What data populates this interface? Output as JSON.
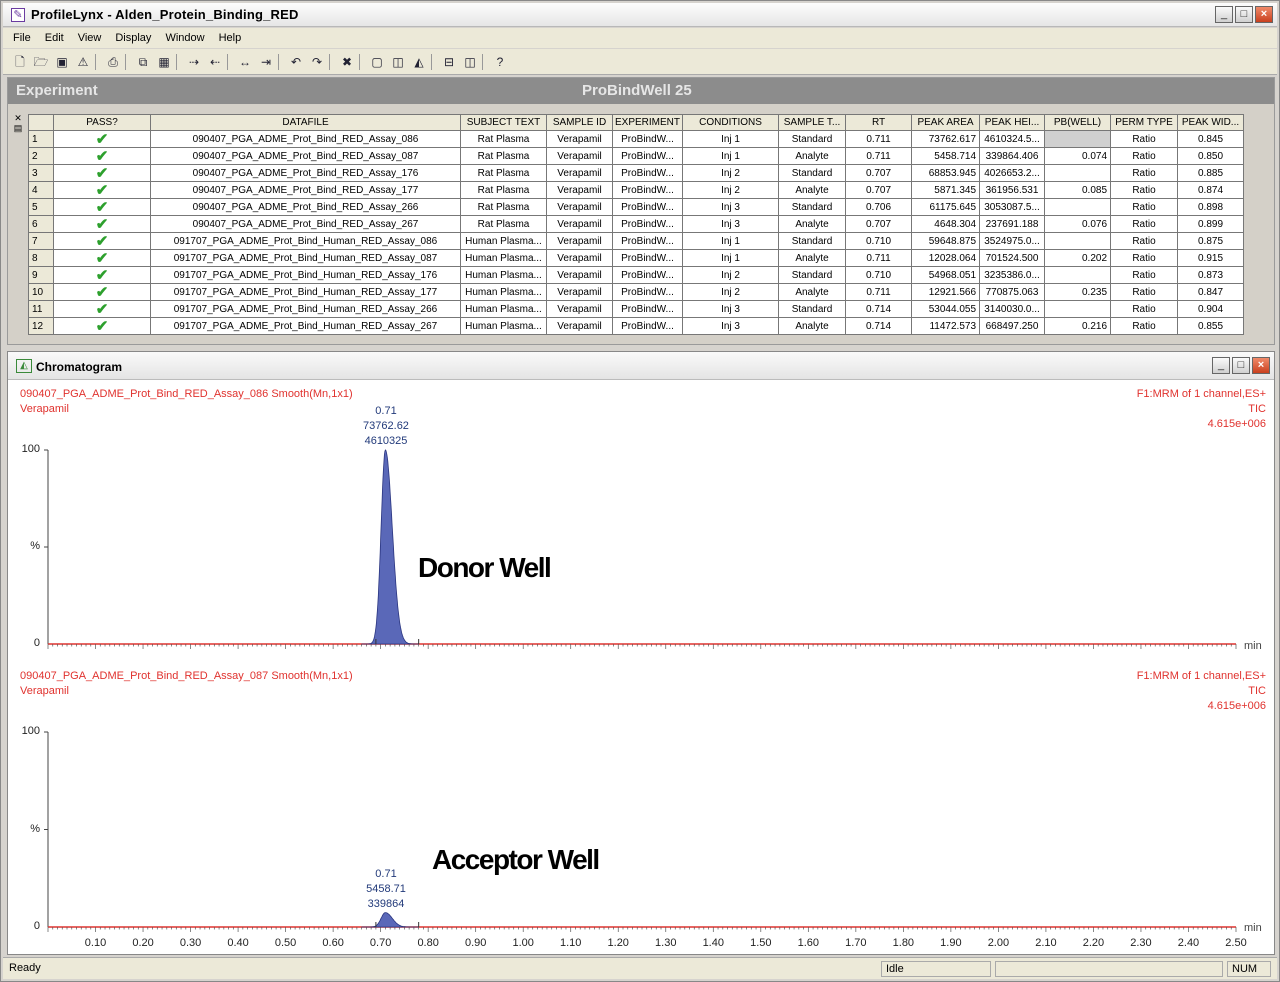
{
  "window": {
    "title": "ProfileLynx - Alden_Protein_Binding_RED"
  },
  "menu": [
    "File",
    "Edit",
    "View",
    "Display",
    "Window",
    "Help"
  ],
  "experiment": {
    "label": "Experiment",
    "name": "ProBindWell 25"
  },
  "grid": {
    "columns": [
      "PASS?",
      "DATAFILE",
      "SUBJECT TEXT",
      "SAMPLE ID",
      "EXPERIMENT",
      "CONDITIONS",
      "SAMPLE T...",
      "RT",
      "PEAK AREA",
      "PEAK HEI...",
      "PB(WELL)",
      "PERM TYPE",
      "PEAK WID..."
    ],
    "rows": [
      {
        "n": "1",
        "file": "090407_PGA_ADME_Prot_Bind_RED_Assay_086",
        "subject": "Rat Plasma",
        "sample": "Verapamil",
        "exp": "ProBindW...",
        "cond": "Inj 1",
        "type": "Standard",
        "rt": "0.711",
        "area": "73762.617",
        "height": "4610324.5...",
        "pb": "",
        "perm": "Ratio",
        "width": "0.845"
      },
      {
        "n": "2",
        "file": "090407_PGA_ADME_Prot_Bind_RED_Assay_087",
        "subject": "Rat Plasma",
        "sample": "Verapamil",
        "exp": "ProBindW...",
        "cond": "Inj 1",
        "type": "Analyte",
        "rt": "0.711",
        "area": "5458.714",
        "height": "339864.406",
        "pb": "0.074",
        "perm": "Ratio",
        "width": "0.850"
      },
      {
        "n": "3",
        "file": "090407_PGA_ADME_Prot_Bind_RED_Assay_176",
        "subject": "Rat Plasma",
        "sample": "Verapamil",
        "exp": "ProBindW...",
        "cond": "Inj 2",
        "type": "Standard",
        "rt": "0.707",
        "area": "68853.945",
        "height": "4026653.2...",
        "pb": "",
        "perm": "Ratio",
        "width": "0.885"
      },
      {
        "n": "4",
        "file": "090407_PGA_ADME_Prot_Bind_RED_Assay_177",
        "subject": "Rat Plasma",
        "sample": "Verapamil",
        "exp": "ProBindW...",
        "cond": "Inj 2",
        "type": "Analyte",
        "rt": "0.707",
        "area": "5871.345",
        "height": "361956.531",
        "pb": "0.085",
        "perm": "Ratio",
        "width": "0.874"
      },
      {
        "n": "5",
        "file": "090407_PGA_ADME_Prot_Bind_RED_Assay_266",
        "subject": "Rat Plasma",
        "sample": "Verapamil",
        "exp": "ProBindW...",
        "cond": "Inj 3",
        "type": "Standard",
        "rt": "0.706",
        "area": "61175.645",
        "height": "3053087.5...",
        "pb": "",
        "perm": "Ratio",
        "width": "0.898"
      },
      {
        "n": "6",
        "file": "090407_PGA_ADME_Prot_Bind_RED_Assay_267",
        "subject": "Rat Plasma",
        "sample": "Verapamil",
        "exp": "ProBindW...",
        "cond": "Inj 3",
        "type": "Analyte",
        "rt": "0.707",
        "area": "4648.304",
        "height": "237691.188",
        "pb": "0.076",
        "perm": "Ratio",
        "width": "0.899"
      },
      {
        "n": "7",
        "file": "091707_PGA_ADME_Prot_Bind_Human_RED_Assay_086",
        "subject": "Human Plasma...",
        "sample": "Verapamil",
        "exp": "ProBindW...",
        "cond": "Inj 1",
        "type": "Standard",
        "rt": "0.710",
        "area": "59648.875",
        "height": "3524975.0...",
        "pb": "",
        "perm": "Ratio",
        "width": "0.875"
      },
      {
        "n": "8",
        "file": "091707_PGA_ADME_Prot_Bind_Human_RED_Assay_087",
        "subject": "Human Plasma...",
        "sample": "Verapamil",
        "exp": "ProBindW...",
        "cond": "Inj 1",
        "type": "Analyte",
        "rt": "0.711",
        "area": "12028.064",
        "height": "701524.500",
        "pb": "0.202",
        "perm": "Ratio",
        "width": "0.915"
      },
      {
        "n": "9",
        "file": "091707_PGA_ADME_Prot_Bind_Human_RED_Assay_176",
        "subject": "Human Plasma...",
        "sample": "Verapamil",
        "exp": "ProBindW...",
        "cond": "Inj 2",
        "type": "Standard",
        "rt": "0.710",
        "area": "54968.051",
        "height": "3235386.0...",
        "pb": "",
        "perm": "Ratio",
        "width": "0.873"
      },
      {
        "n": "10",
        "file": "091707_PGA_ADME_Prot_Bind_Human_RED_Assay_177",
        "subject": "Human Plasma...",
        "sample": "Verapamil",
        "exp": "ProBindW...",
        "cond": "Inj 2",
        "type": "Analyte",
        "rt": "0.711",
        "area": "12921.566",
        "height": "770875.063",
        "pb": "0.235",
        "perm": "Ratio",
        "width": "0.847"
      },
      {
        "n": "11",
        "file": "091707_PGA_ADME_Prot_Bind_Human_RED_Assay_266",
        "subject": "Human Plasma...",
        "sample": "Verapamil",
        "exp": "ProBindW...",
        "cond": "Inj 3",
        "type": "Standard",
        "rt": "0.714",
        "area": "53044.055",
        "height": "3140030.0...",
        "pb": "",
        "perm": "Ratio",
        "width": "0.904"
      },
      {
        "n": "12",
        "file": "091707_PGA_ADME_Prot_Bind_Human_RED_Assay_267",
        "subject": "Human Plasma...",
        "sample": "Verapamil",
        "exp": "ProBindW...",
        "cond": "Inj 3",
        "type": "Analyte",
        "rt": "0.714",
        "area": "11472.573",
        "height": "668497.250",
        "pb": "0.216",
        "perm": "Ratio",
        "width": "0.855"
      }
    ]
  },
  "chromatogram": {
    "title": "Chromatogram",
    "traces": [
      {
        "header": "090407_PGA_ADME_Prot_Bind_RED_Assay_086  Smooth(Mn,1x1)",
        "compound": "Verapamil",
        "right1": "F1:MRM of 1 channel,ES+",
        "right2": "TIC",
        "right3": "4.615e+006",
        "peak_rt": "0.71",
        "peak_area": "73762.62",
        "peak_height": "4610325",
        "annotation": "Donor Well"
      },
      {
        "header": "090407_PGA_ADME_Prot_Bind_RED_Assay_087  Smooth(Mn,1x1)",
        "compound": "Verapamil",
        "right1": "F1:MRM of 1 channel,ES+",
        "right2": "TIC",
        "right3": "4.615e+006",
        "peak_rt": "0.71",
        "peak_area": "5458.71",
        "peak_height": "339864",
        "annotation": "Acceptor Well"
      }
    ],
    "y_ticks": [
      "100",
      "%",
      "0"
    ],
    "x_unit": "min",
    "x_ticks": [
      "0.10",
      "0.20",
      "0.30",
      "0.40",
      "0.50",
      "0.60",
      "0.70",
      "0.80",
      "0.90",
      "1.00",
      "1.10",
      "1.20",
      "1.30",
      "1.40",
      "1.50",
      "1.60",
      "1.70",
      "1.80",
      "1.90",
      "2.00",
      "2.10",
      "2.20",
      "2.30",
      "2.40",
      "2.50"
    ]
  },
  "chart_data": [
    {
      "type": "area",
      "xlim": [
        0.0,
        2.5
      ],
      "ylim": [
        0,
        100
      ],
      "peaks": [
        {
          "rt": 0.71,
          "relative_height": 100,
          "area": 73762.62,
          "height": 4610325
        }
      ]
    },
    {
      "type": "area",
      "xlim": [
        0.0,
        2.5
      ],
      "ylim": [
        0,
        100
      ],
      "peaks": [
        {
          "rt": 0.71,
          "relative_height": 7.4,
          "area": 5458.71,
          "height": 339864
        }
      ]
    }
  ],
  "status": {
    "left": "Ready",
    "middle": "Idle",
    "right": "NUM"
  },
  "colors": {
    "trace_fill": "#5a68b8",
    "trace_text": "#e0322e",
    "baseline": "#e0322e",
    "check": "#2da02d"
  }
}
